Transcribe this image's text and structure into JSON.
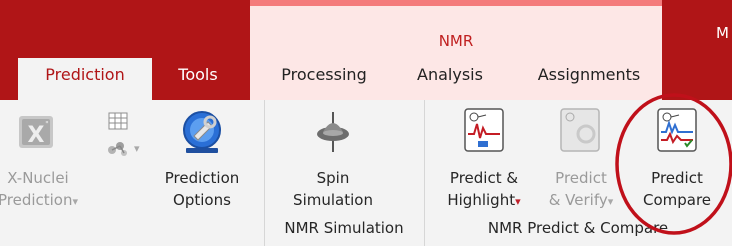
{
  "header": {
    "context_group_label": "NMR",
    "right_edge_letter": "M"
  },
  "tabs": [
    {
      "label": "Prediction",
      "active": true
    },
    {
      "label": "Tools"
    },
    {
      "label": "Processing"
    },
    {
      "label": "Analysis"
    },
    {
      "label": "Assignments"
    }
  ],
  "ribbon": {
    "xnuclei": {
      "line1": "X-Nuclei",
      "line2": "Prediction",
      "enabled": false
    },
    "prediction_options": {
      "line1": "Prediction",
      "line2": "Options"
    },
    "spin_simulation": {
      "line1": "Spin",
      "line2": "Simulation"
    },
    "predict_highlight": {
      "line1": "Predict &",
      "line2": "Highlight"
    },
    "predict_verify": {
      "line1": "Predict",
      "line2": "& Verify",
      "enabled": false
    },
    "predict_compare": {
      "line1": "Predict",
      "line2": "Compare",
      "highlighted": true
    },
    "groups": {
      "nmr_simulation": "NMR Simulation",
      "nmr_predict_compare": "NMR Predict & Compare"
    }
  },
  "colors": {
    "title_bar": "#b01517",
    "context_group": "#fde7e6",
    "active_tab_text": "#b01517",
    "highlight_circle": "#c0101a"
  },
  "icons": [
    "x-nuclei-icon",
    "table-icon",
    "molecule-icon",
    "prediction-options-icon",
    "spin-simulation-icon",
    "predict-highlight-icon",
    "predict-verify-icon",
    "predict-compare-icon",
    "dropdown-arrow-icon"
  ]
}
